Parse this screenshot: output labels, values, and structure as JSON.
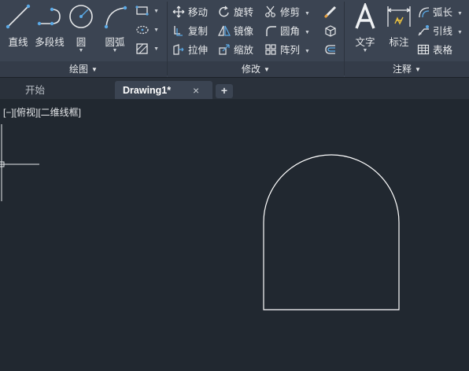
{
  "ribbon": {
    "draw_panel": {
      "title": "绘图",
      "line": "直线",
      "polyline": "多段线",
      "circle": "圆",
      "arc": "圆弧"
    },
    "modify_panel": {
      "title": "修改",
      "move": "移动",
      "rotate": "旋转",
      "trim": "修剪",
      "copy": "复制",
      "mirror": "镜像",
      "fillet": "圆角",
      "stretch": "拉伸",
      "scale": "缩放",
      "array": "阵列"
    },
    "annotation_panel": {
      "title": "注释",
      "text": "文字",
      "dimension": "标注",
      "arc_length": "弧长",
      "leader": "引线",
      "table": "表格"
    }
  },
  "tabs": [
    {
      "label": "开始"
    },
    {
      "label": "Drawing1*"
    }
  ],
  "tab_close": "×",
  "tab_add": "+",
  "viewport": {
    "controls": "[−][俯视][二维线框]"
  },
  "colors": {
    "ribbon_bg": "#3b4452",
    "canvas_bg": "#212830",
    "accent_blue": "#5aa9e6",
    "drawing_stroke": "#ffffff"
  }
}
